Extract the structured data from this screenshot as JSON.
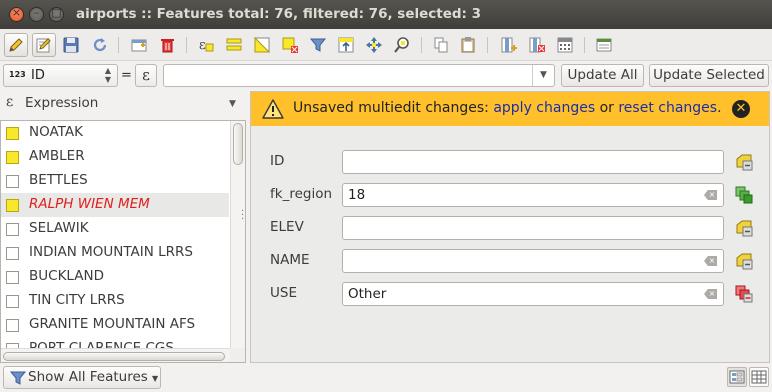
{
  "window": {
    "title": "airports :: Features total: 76, filtered: 76, selected: 3",
    "close_glyph": "×",
    "min_glyph": "–",
    "max_glyph": "□"
  },
  "toolbar": {
    "icons": [
      "edit-pencil-icon",
      "multi-edit-icon",
      "save-edits-icon",
      "reload-icon",
      "new-feature-icon",
      "delete-feature-icon",
      "select-by-expression-icon",
      "select-all-icon",
      "invert-selection-icon",
      "deselect-all-icon",
      "filter-select-icon",
      "move-selection-to-top-icon",
      "pan-to-selected-icon",
      "zoom-to-selected-icon",
      "copy-rows-icon",
      "paste-features-icon",
      "new-field-icon",
      "delete-field-icon",
      "field-calculator-icon",
      "conditional-formatting-icon"
    ]
  },
  "expression_bar": {
    "field_type_badge": "123",
    "field": "ID",
    "equals": "=",
    "epsilon": "ε",
    "value": "",
    "update_all_label": "Update All",
    "update_selected_label": "Update Selected"
  },
  "preview_column": {
    "label": "Expression",
    "epsilon": "ε"
  },
  "features": [
    {
      "label": "NOATAK",
      "selected": true,
      "current": false
    },
    {
      "label": "AMBLER",
      "selected": true,
      "current": false
    },
    {
      "label": "BETTLES",
      "selected": false,
      "current": false
    },
    {
      "label": "RALPH WIEN MEM",
      "selected": true,
      "current": true
    },
    {
      "label": "SELAWIK",
      "selected": false,
      "current": false
    },
    {
      "label": "INDIAN MOUNTAIN LRRS",
      "selected": false,
      "current": false
    },
    {
      "label": "BUCKLAND",
      "selected": false,
      "current": false
    },
    {
      "label": "TIN CITY LRRS",
      "selected": false,
      "current": false
    },
    {
      "label": "GRANITE MOUNTAIN AFS",
      "selected": false,
      "current": false
    },
    {
      "label": "PORT CLARENCE CGS",
      "selected": false,
      "current": false
    }
  ],
  "banner": {
    "message_prefix": "Unsaved multiedit changes: ",
    "apply_link": "apply changes",
    "message_middle": " or ",
    "reset_link": "reset changes",
    "message_suffix": ".",
    "close_glyph": "✕",
    "color": "#ffc02b"
  },
  "form": {
    "fields": [
      {
        "label": "ID",
        "value": "",
        "has_clear": false,
        "status_icon": "mixed-values-icon",
        "status_color": "#e6c619"
      },
      {
        "label": "fk_region",
        "value": "18",
        "has_clear": true,
        "status_icon": "all-same-icon",
        "status_color": "#3c9a2e"
      },
      {
        "label": "ELEV",
        "value": "",
        "has_clear": false,
        "status_icon": "mixed-values-icon",
        "status_color": "#e6c619"
      },
      {
        "label": "NAME",
        "value": "",
        "has_clear": true,
        "status_icon": "mixed-values-icon",
        "status_color": "#e6c619"
      },
      {
        "label": "USE",
        "value": "Other",
        "has_clear": true,
        "status_icon": "changed-values-icon",
        "status_color": "#d2262e"
      }
    ]
  },
  "bottom": {
    "show_all_label": "Show All Features",
    "view_buttons": [
      "form-view-icon",
      "table-view-icon"
    ]
  }
}
